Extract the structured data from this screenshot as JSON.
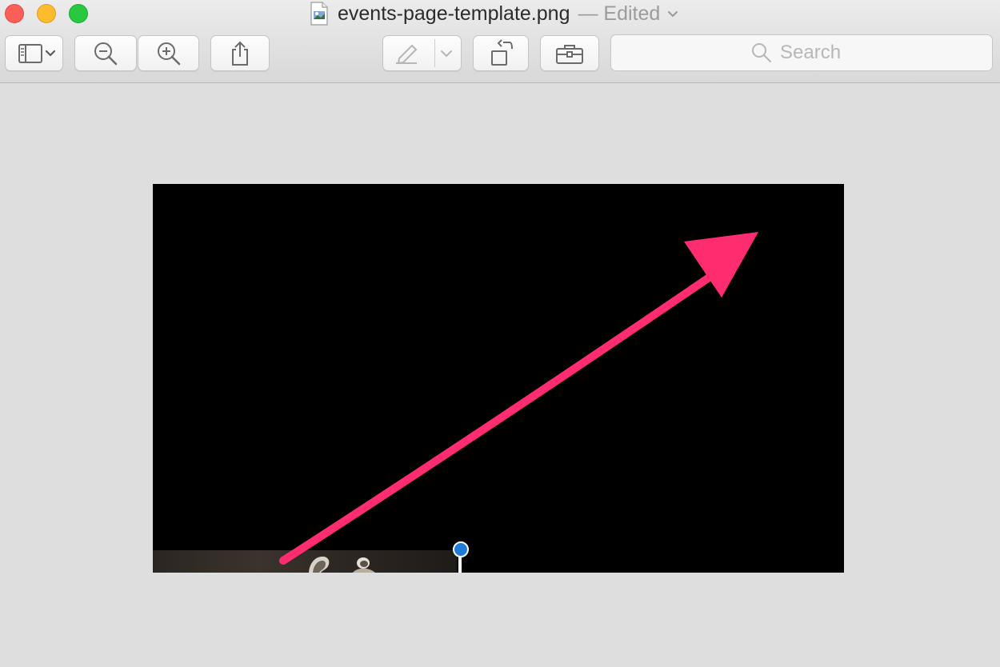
{
  "window": {
    "title": "events-page-template.png",
    "status": "— Edited",
    "icons": {
      "close": "close-button",
      "minimize": "minimize-button",
      "zoom": "zoom-button",
      "document": "png-document-icon"
    }
  },
  "toolbar": {
    "buttons": [
      {
        "name": "sidebar-toggle",
        "icon": "sidebar-icon"
      },
      {
        "name": "zoom-out",
        "icon": "zoom-out-icon"
      },
      {
        "name": "zoom-in",
        "icon": "zoom-in-icon"
      },
      {
        "name": "share",
        "icon": "share-icon"
      },
      {
        "name": "markup",
        "icon": "pen-icon"
      },
      {
        "name": "rotate",
        "icon": "rotate-left-icon"
      },
      {
        "name": "toolbox",
        "icon": "toolbox-icon"
      }
    ],
    "search": {
      "placeholder": "Search",
      "value": ""
    }
  },
  "canvas": {
    "annotation": {
      "type": "arrow",
      "color": "#ff2d6f"
    },
    "selection_handle_color": "#1f7ad8"
  }
}
